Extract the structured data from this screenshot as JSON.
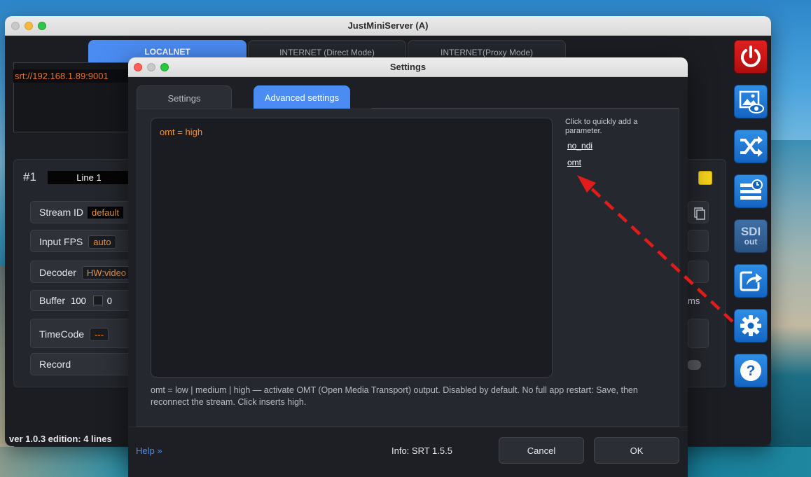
{
  "main_window": {
    "title": "JustMiniServer (A)",
    "tabs": [
      "LOCALNET",
      "INTERNET (Direct Mode)",
      "INTERNET(Proxy Mode)"
    ],
    "url": "srt://192.168.1.89:9001",
    "line": {
      "number": "#1",
      "name": "Line 1",
      "stream_id_label": "Stream ID",
      "stream_id_value": "default",
      "input_fps_label": "Input FPS",
      "input_fps_value": "auto",
      "decoder_label": "Decoder",
      "decoder_value": "HW:video",
      "buffer_label": "Buffer",
      "buffer_value": "100",
      "buffer_value2": "0",
      "buffer_unit": "ms",
      "timecode_label": "TimeCode",
      "timecode_value": "---",
      "record_label": "Record"
    },
    "version_text": "ver 1.0.3  edition: 4 lines"
  },
  "toolbar": {
    "sdi_top": "SDI",
    "sdi_bottom": "out",
    "help_glyph": "?"
  },
  "dialog": {
    "title": "Settings",
    "tabs": [
      "Settings",
      "Advanced settings"
    ],
    "param_value": "omt = high",
    "quick_hint": "Click to quickly add a parameter.",
    "quick_params": [
      "no_ndi",
      "omt"
    ],
    "help_text": "omt = low | medium | high — activate OMT (Open Media Transport) output. Disabled by default. No full app restart: Save, then reconnect the stream. Click inserts high.",
    "help_link": "Help »",
    "info": "Info: SRT 1.5.5",
    "cancel_label": "Cancel",
    "ok_label": "OK"
  },
  "colors": {
    "accent": "#4b8cf2",
    "value_orange": "#f0913f",
    "arrow_red": "#e21b1b"
  }
}
